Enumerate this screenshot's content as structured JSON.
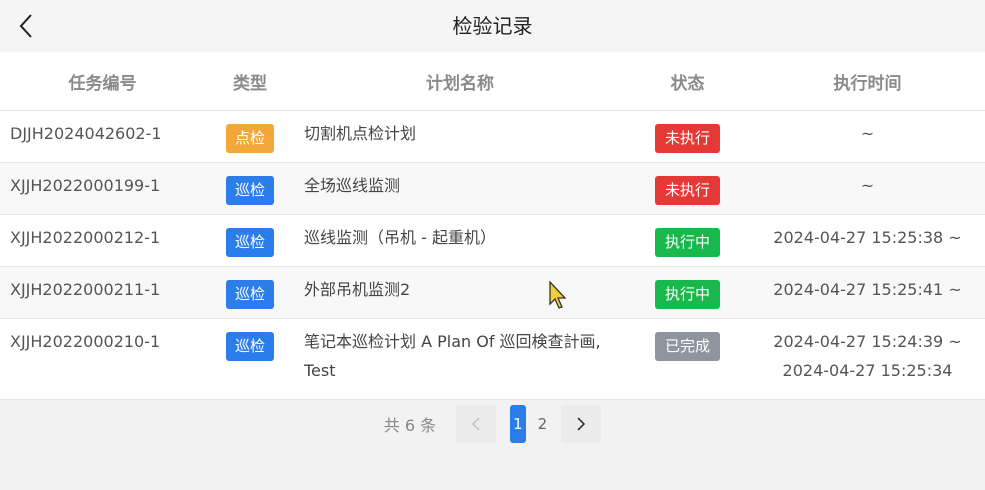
{
  "header": {
    "title": "检验记录",
    "back_icon": "chevron-left-icon"
  },
  "table": {
    "columns": [
      "任务编号",
      "类型",
      "计划名称",
      "状态",
      "执行时间"
    ],
    "rows": [
      {
        "id": "DJJH2024042602-1",
        "type": "点检",
        "type_color": "#f3a73b",
        "name": "切割机点检计划",
        "status": "未执行",
        "status_color": "#e53935",
        "time": "~"
      },
      {
        "id": "XJJH2022000199-1",
        "type": "巡检",
        "type_color": "#2b7de9",
        "name": "全场巡线监测",
        "status": "未执行",
        "status_color": "#e53935",
        "time": "~"
      },
      {
        "id": "XJJH2022000212-1",
        "type": "巡检",
        "type_color": "#2b7de9",
        "name": "巡线监测（吊机 - 起重机）",
        "status": "执行中",
        "status_color": "#19b84d",
        "time": "2024-04-27 15:25:38 ~"
      },
      {
        "id": "XJJH2022000211-1",
        "type": "巡检",
        "type_color": "#2b7de9",
        "name": "外部吊机监测2",
        "status": "执行中",
        "status_color": "#19b84d",
        "time": "2024-04-27 15:25:41 ~"
      },
      {
        "id": "XJJH2022000210-1",
        "type": "巡检",
        "type_color": "#2b7de9",
        "name": "笔记本巡检计划 A Plan Of 巡回検查計画, Test",
        "status": "已完成",
        "status_color": "#8f959e",
        "time": "2024-04-27 15:24:39 ~",
        "time2": "2024-04-27 15:25:34"
      }
    ]
  },
  "pagination": {
    "total": "共 6 条",
    "pages": [
      "1",
      "2"
    ],
    "current": "1",
    "prev_icon": "chevron-left-icon",
    "next_icon": "chevron-right-icon"
  }
}
